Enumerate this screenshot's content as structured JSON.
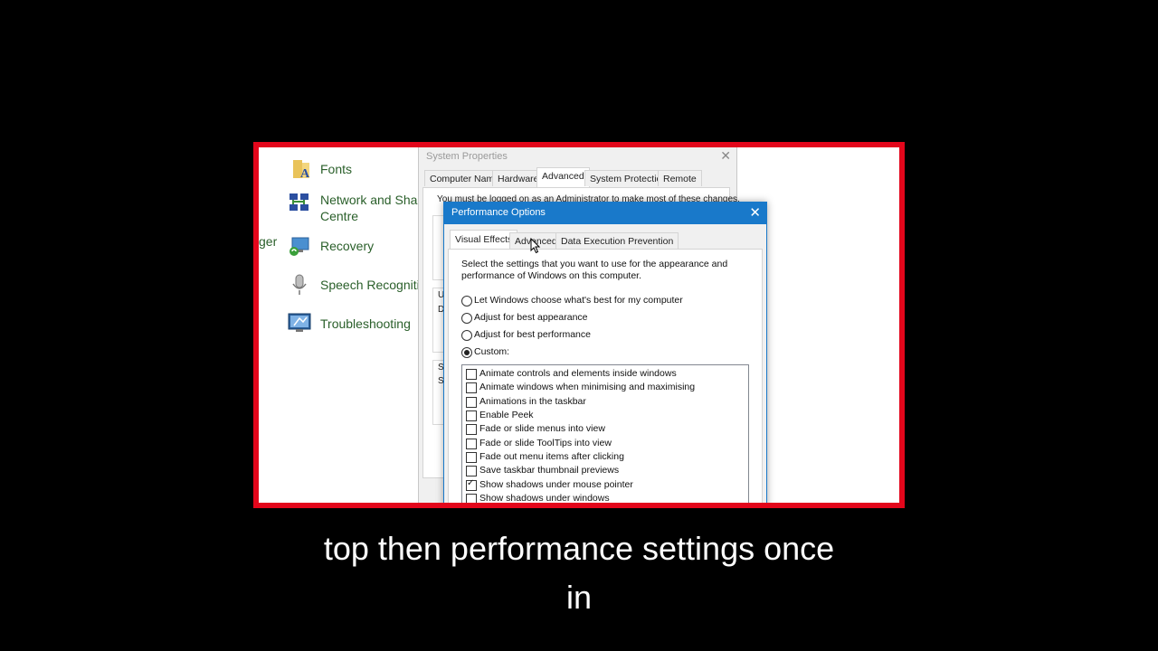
{
  "control_panel": {
    "partial_item": "ger",
    "items": [
      {
        "label_line1": "Fonts",
        "label_line2": "",
        "icon": "fonts-folder-icon"
      },
      {
        "label_line1": "Network and Shari",
        "label_line2": "Centre",
        "icon": "network-icon"
      },
      {
        "label_line1": "Recovery",
        "label_line2": "",
        "icon": "recovery-icon"
      },
      {
        "label_line1": "Speech Recognitio",
        "label_line2": "",
        "icon": "microphone-icon"
      },
      {
        "label_line1": "Troubleshooting",
        "label_line2": "",
        "icon": "troubleshooting-icon"
      }
    ]
  },
  "system_properties": {
    "title": "System Properties",
    "close": "✕",
    "tabs": [
      "Computer Name",
      "Hardware",
      "Advanced",
      "System Protection",
      "Remote"
    ],
    "active_tab": "Advanced",
    "message": "You must be logged on as an Administrator to make most of these changes.",
    "fragments": [
      "V",
      "U",
      "D",
      "S",
      "S"
    ]
  },
  "performance_options": {
    "title": "Performance Options",
    "close": "✕",
    "tabs": [
      "Visual Effects",
      "Advanced",
      "Data Execution Prevention"
    ],
    "active_tab": "Visual Effects",
    "description": "Select the settings that you want to use for the appearance and performance of Windows on this computer.",
    "options": [
      {
        "label": "Let Windows choose what's best for my computer",
        "selected": false
      },
      {
        "label": "Adjust for best appearance",
        "selected": false
      },
      {
        "label": "Adjust for best performance",
        "selected": false
      },
      {
        "label": "Custom:",
        "selected": true
      }
    ],
    "effects": [
      {
        "label": "Animate controls and elements inside windows",
        "checked": false
      },
      {
        "label": "Animate windows when minimising and maximising",
        "checked": false
      },
      {
        "label": "Animations in the taskbar",
        "checked": false
      },
      {
        "label": "Enable Peek",
        "checked": false
      },
      {
        "label": "Fade or slide menus into view",
        "checked": false
      },
      {
        "label": "Fade or slide ToolTips into view",
        "checked": false
      },
      {
        "label": "Fade out menu items after clicking",
        "checked": false
      },
      {
        "label": "Save taskbar thumbnail previews",
        "checked": false
      },
      {
        "label": "Show shadows under mouse pointer",
        "checked": true
      },
      {
        "label": "Show shadows under windows",
        "checked": false
      }
    ]
  },
  "caption": {
    "line1": "top then performance settings once",
    "line2": "in"
  },
  "colors": {
    "frame": "#e3061b",
    "titlebar": "#1979ca",
    "link_green": "#2a5f2a"
  }
}
